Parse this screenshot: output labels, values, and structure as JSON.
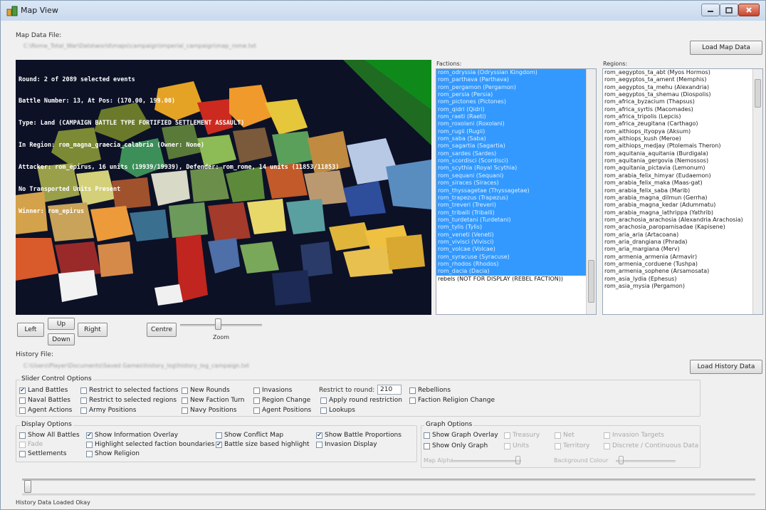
{
  "window": {
    "title": "Map View"
  },
  "map_data": {
    "label": "Map Data File:",
    "path": "C:\\Rome_Total_War\\Data\\world\\maps\\campaign\\imperial_campaign\\map_rome.txt",
    "load_button": "Load Map Data"
  },
  "map": {
    "overlay_lines": [
      "Round: 2 of 2089 selected events",
      "Battle Number: 13, At Pos: (170.00, 199.00)",
      "Type: Land (CAMPAIGN BATTLE TYPE FORTIFIED SETTLEMENT ASSAULT)",
      "In Region: rom_magna_graecia_calabria (Owner: None)",
      "Attacker: rom_epirus, 16 units (19939/19939), Defender: rom_rome, 14 units (11853/11853)",
      "No Transported Units Present",
      "Winner: rom_epirus"
    ]
  },
  "nav": {
    "left": "Left",
    "up": "Up",
    "down": "Down",
    "right": "Right",
    "centre": "Centre",
    "zoom_label": "Zoom"
  },
  "factions": {
    "label": "Factions:",
    "items": [
      "rom_odryssia (Odryssian Kingdom)",
      "rom_parthava (Parthava)",
      "rom_pergamon (Pergamon)",
      "rom_persia (Persia)",
      "rom_pictones (Pictones)",
      "rom_qidri (Qidri)",
      "rom_raeti (Raeti)",
      "rom_roxolani (Roxolani)",
      "rom_rugii (Rugii)",
      "rom_saba (Saba)",
      "rom_sagartia (Sagartia)",
      "rom_sardes (Sardes)",
      "rom_scordisci (Scordisci)",
      "rom_scythia (Royal Scythia)",
      "rom_sequani (Sequani)",
      "rom_siraces (Siraces)",
      "rom_thyssagetae (Thyssagetae)",
      "rom_trapezus (Trapezus)",
      "rom_treveri (Treveri)",
      "rom_triballi (Triballi)",
      "rom_turdetani (Turdetani)",
      "rom_tylis (Tylis)",
      "rom_veneti (Veneti)",
      "rom_vivisci (Vivisci)",
      "rom_volcae (Volcae)",
      "rom_syracuse (Syracuse)",
      "rom_rhodos (Rhodos)",
      "rom_dacia (Dacia)",
      "rebels (NOT FOR DISPLAY (REBEL FACTION))"
    ]
  },
  "regions": {
    "label": "Regions:",
    "items": [
      "rom_aegyptos_ta_abt (Myos Hormos)",
      "rom_aegyptos_ta_ament (Memphis)",
      "rom_aegyptos_ta_mehu (Alexandria)",
      "rom_aegyptos_ta_shemau (Diospolis)",
      "rom_africa_byzacium (Thapsus)",
      "rom_africa_syrtis (Macomades)",
      "rom_africa_tripolis (Lepcis)",
      "rom_africa_zeugitana (Carthago)",
      "rom_aithiops_ityopya (Aksum)",
      "rom_aithiops_kush (Meroe)",
      "rom_aithiops_medjay (Ptolemais Theron)",
      "rom_aquitania_aquitania (Burdigala)",
      "rom_aquitania_gergovia (Nemossos)",
      "rom_aquitania_pictavia (Lemonum)",
      "rom_arabia_felix_himyar (Eudaemon)",
      "rom_arabia_felix_maka (Maas-gat)",
      "rom_arabia_felix_saba (Marib)",
      "rom_arabia_magna_dilmun (Gerrha)",
      "rom_arabia_magna_kedar (Adummatu)",
      "rom_arabia_magna_lathrippa (Yathrib)",
      "rom_arachosia_arachosia (Alexandria Arachosia)",
      "rom_arachosia_paropamisadae (Kapisene)",
      "rom_aria_aria (Artacoana)",
      "rom_aria_drangiana (Phrada)",
      "rom_aria_margiana (Merv)",
      "rom_armenia_armenia (Armavir)",
      "rom_armenia_corduene (Tushpa)",
      "rom_armenia_sophene (Arsamosata)",
      "rom_asia_lydia (Ephesus)",
      "rom_asia_mysia (Pergamon)"
    ]
  },
  "history": {
    "label": "History File:",
    "path": "C:\\Users\\Player\\Documents\\Saved Games\\history_log\\history_log_campaign.txt",
    "load_button": "Load History Data"
  },
  "slider_options": {
    "title": "Slider Control Options",
    "land_battles": "Land Battles",
    "naval_battles": "Naval Battles",
    "agent_actions": "Agent Actions",
    "restrict_factions": "Restrict to selected factions",
    "restrict_regions": "Restrict to selected regions",
    "army_positions": "Army Positions",
    "new_rounds": "New Rounds",
    "new_faction_turn": "New Faction Turn",
    "navy_positions": "Navy Positions",
    "invasions": "Invasions",
    "region_change": "Region Change",
    "agent_positions": "Agent Positions",
    "restrict_round_label": "Restrict to round:",
    "restrict_round_value": "210",
    "apply_round_restriction": "Apply round restriction",
    "lookups": "Lookups",
    "rebellions": "Rebellions",
    "faction_religion_change": "Faction Religion Change"
  },
  "display_options": {
    "title": "Display Options",
    "show_all_battles": "Show All Battles",
    "fade": "Fade",
    "settlements": "Settlements",
    "show_information_overlay": "Show Information Overlay",
    "highlight_faction_boundaries": "Highlight selected faction boundaries",
    "show_religion": "Show Religion",
    "show_conflict_map": "Show Conflict Map",
    "battle_size_highlight": "Battle size based highlight",
    "show_battle_proportions": "Show Battle Proportions",
    "invasion_display": "Invasion Display"
  },
  "graph_options": {
    "title": "Graph Options",
    "show_graph_overlay": "Show Graph Overlay",
    "show_only_graph": "Show Only Graph",
    "treasury": "Treasury",
    "units": "Units",
    "net": "Net",
    "territory": "Territory",
    "invasion_targets": "Invasion Targets",
    "discrete_continuous": "Discrete / Continuous Data",
    "map_alpha": "Map Alpha",
    "background_colour": "Background Colour"
  },
  "status": {
    "text": "History Data Loaded Okay"
  },
  "colors": {
    "selection": "#3399ff",
    "map_background": "#0c1126"
  }
}
